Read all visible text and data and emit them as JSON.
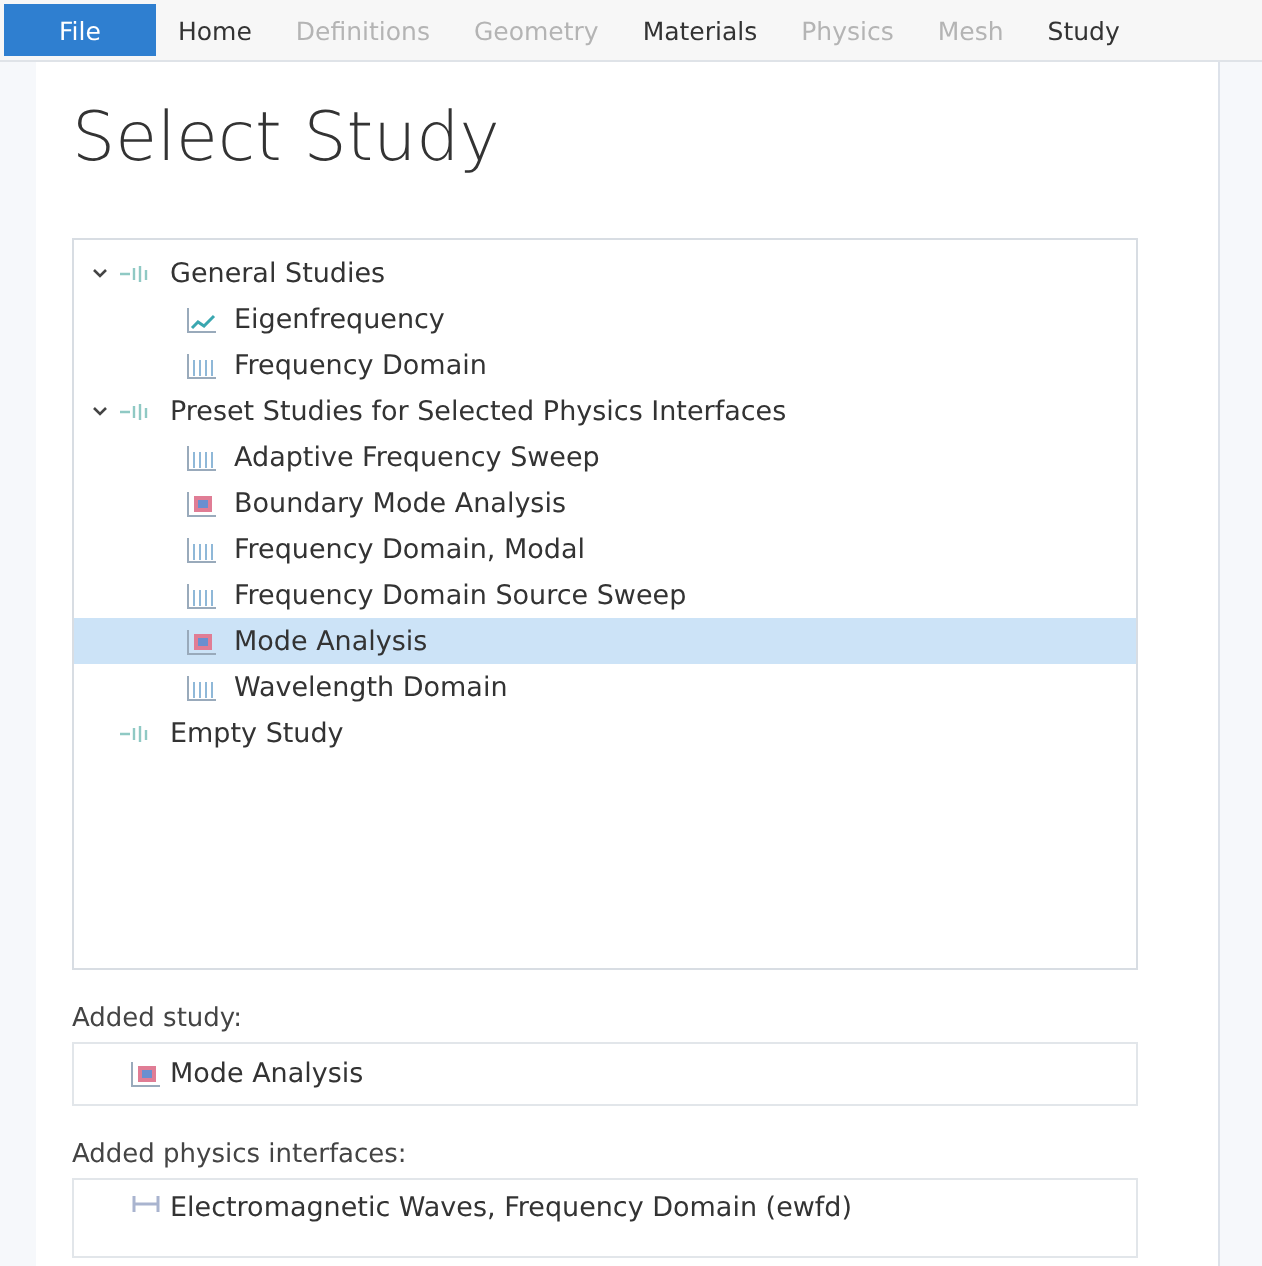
{
  "ribbon_tabs": [
    {
      "label": "File",
      "kind": "file"
    },
    {
      "label": "Home",
      "kind": "tab",
      "disabled": false
    },
    {
      "label": "Definitions",
      "kind": "tab",
      "disabled": true
    },
    {
      "label": "Geometry",
      "kind": "tab",
      "disabled": true
    },
    {
      "label": "Materials",
      "kind": "tab",
      "disabled": false
    },
    {
      "label": "Physics",
      "kind": "tab",
      "disabled": true
    },
    {
      "label": "Mesh",
      "kind": "tab",
      "disabled": true
    },
    {
      "label": "Study",
      "kind": "tab",
      "disabled": false
    }
  ],
  "title": "Select Study",
  "tree": [
    {
      "label": "General Studies",
      "kind": "group",
      "expanded": true,
      "selected": false,
      "children": [
        {
          "label": "Eigenfrequency",
          "kind": "eigen",
          "selected": false
        },
        {
          "label": "Frequency Domain",
          "kind": "sweep",
          "selected": false
        }
      ]
    },
    {
      "label": "Preset Studies for Selected Physics Interfaces",
      "kind": "group",
      "expanded": true,
      "selected": false,
      "children": [
        {
          "label": "Adaptive Frequency Sweep",
          "kind": "sweep",
          "selected": false
        },
        {
          "label": "Boundary Mode Analysis",
          "kind": "mode",
          "selected": false
        },
        {
          "label": "Frequency Domain, Modal",
          "kind": "sweep",
          "selected": false
        },
        {
          "label": "Frequency Domain Source Sweep",
          "kind": "sweep",
          "selected": false
        },
        {
          "label": "Mode Analysis",
          "kind": "mode",
          "selected": true
        },
        {
          "label": "Wavelength Domain",
          "kind": "sweep",
          "selected": false
        }
      ]
    },
    {
      "label": "Empty Study",
      "kind": "group",
      "selected": false
    }
  ],
  "added_study": {
    "label": "Added study:",
    "item": {
      "label": "Mode Analysis",
      "kind": "mode"
    }
  },
  "added_physics": {
    "label": "Added physics interfaces:",
    "item": {
      "label": "Electromagnetic Waves, Frequency Domain (ewfd)",
      "kind": "physics"
    }
  }
}
